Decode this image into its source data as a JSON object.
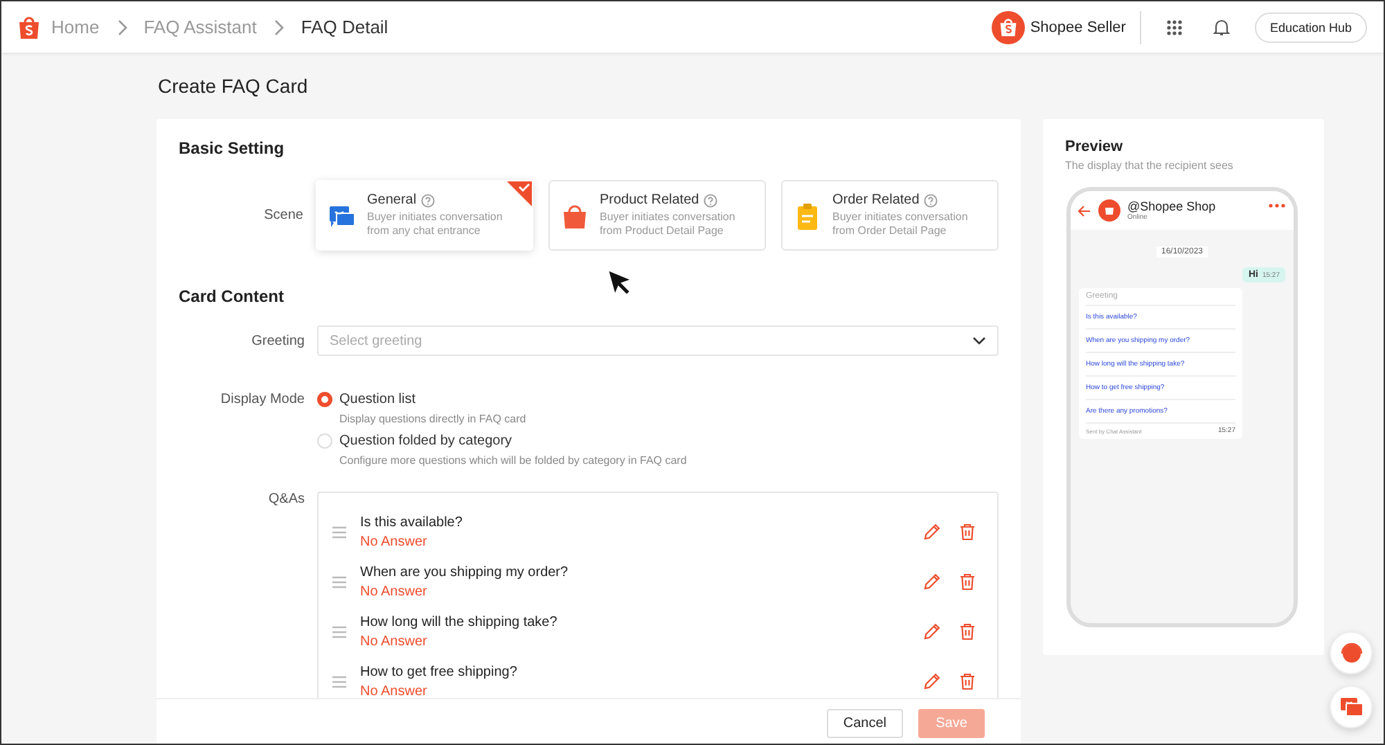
{
  "breadcrumbs": [
    {
      "label": "Home",
      "current": false
    },
    {
      "label": "FAQ Assistant",
      "current": false
    },
    {
      "label": "FAQ Detail",
      "current": true
    }
  ],
  "header": {
    "brand": "Shopee Seller",
    "button": "Education Hub"
  },
  "page_title": "Create FAQ Card",
  "basic_setting": {
    "title": "Basic Setting",
    "scene_label": "Scene",
    "scenes": [
      {
        "kind": "chat",
        "title": "General",
        "description": "Buyer initiates conversation from any chat entrance",
        "selected": true
      },
      {
        "kind": "bag",
        "title": "Product Related",
        "description": "Buyer initiates conversation from Product Detail Page",
        "selected": false
      },
      {
        "kind": "clipboard",
        "title": "Order Related",
        "description": "Buyer initiates conversation from Order Detail Page",
        "selected": false
      }
    ]
  },
  "card_content": {
    "title": "Card Content",
    "greeting_label": "Greeting",
    "greeting": {
      "placeholder": "Select greeting"
    },
    "display_mode_label": "Display Mode",
    "display_modes": [
      {
        "label": "Question list",
        "description": "Display questions directly in FAQ card",
        "selected": true
      },
      {
        "label": "Question folded by category",
        "description": "Configure more questions which will be folded by category in FAQ card",
        "selected": false
      }
    ],
    "qas_label": "Q&As",
    "qas": [
      {
        "question": "Is this available?",
        "answer": "No Answer"
      },
      {
        "question": "When are you shipping my order?",
        "answer": "No Answer"
      },
      {
        "question": "How long will the shipping take?",
        "answer": "No Answer"
      },
      {
        "question": "How to get free shipping?",
        "answer": "No Answer"
      }
    ]
  },
  "footer": {
    "buttons": [
      {
        "label": "Cancel",
        "kind": "secondary",
        "disabled": false
      },
      {
        "label": "Save",
        "kind": "primary",
        "disabled": true
      }
    ]
  },
  "preview": {
    "title": "Preview",
    "subtitle": "The display that the recipient sees",
    "shop": "@Shopee Shop",
    "status": "Online",
    "date": "16/10/2023",
    "message": {
      "text": "Hi",
      "time": "15:27"
    },
    "faq_card": {
      "greeting": "Greeting",
      "questions": [
        "Is this available?",
        "When are you shipping my order?",
        "How long will the shipping take?",
        "How to get free shipping?",
        "Are there any promotions?"
      ],
      "sender": "Sent by Chat Assistant",
      "time": "15:27"
    }
  }
}
